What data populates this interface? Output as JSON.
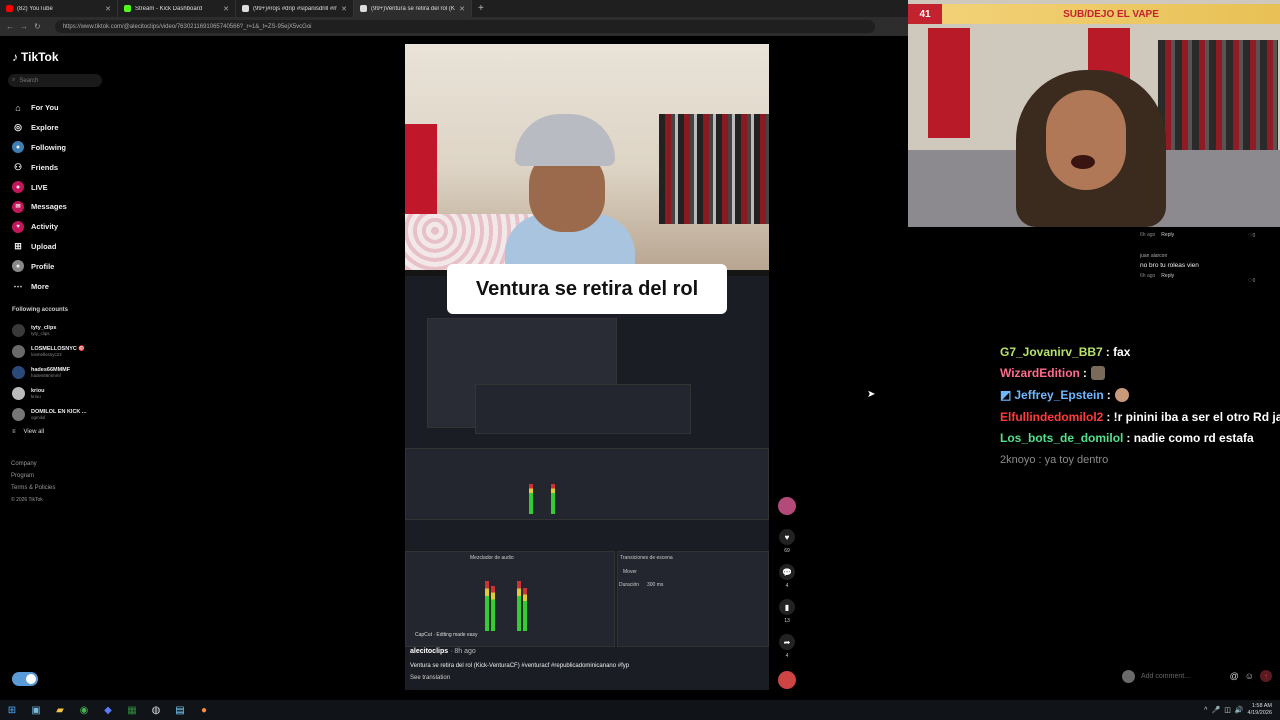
{
  "browser": {
    "tabs": [
      {
        "label": "(82) YouTube",
        "color": "#ff0000"
      },
      {
        "label": "Stream - Kick Dashboard",
        "color": "#53fc18"
      },
      {
        "label": "(99+)#rojs #drip #sipanisdrill #m",
        "color": "#ffffff"
      },
      {
        "label": "(99+)Ventura se retira del rol (Kic",
        "color": "#ffffff"
      }
    ],
    "url": "https://www.tiktok.com/@alecitoclips/video/7630211691065740566?_r=1&_t=ZS-95ejX5vcGoi"
  },
  "tiktok": {
    "logo": "TikTok",
    "search_placeholder": "Search",
    "menu": [
      {
        "label": "For You",
        "icon": "home-icon"
      },
      {
        "label": "Explore",
        "icon": "compass-icon"
      },
      {
        "label": "Following",
        "icon": "following-icon"
      },
      {
        "label": "Friends",
        "icon": "friends-icon"
      },
      {
        "label": "LIVE",
        "icon": "live-icon"
      },
      {
        "label": "Messages",
        "icon": "messages-icon"
      },
      {
        "label": "Activity",
        "icon": "activity-icon"
      },
      {
        "label": "Upload",
        "icon": "upload-icon"
      },
      {
        "label": "Profile",
        "icon": "profile-icon"
      },
      {
        "label": "More",
        "icon": "more-icon"
      }
    ],
    "following_title": "Following accounts",
    "accounts": [
      {
        "name": "tyty_clips",
        "handle": "tyty_clips"
      },
      {
        "name": "LOSMELLOSNYC 🎯",
        "handle": "losmellosnyc22"
      },
      {
        "name": "hades66MMMF",
        "handle": "hades66mmmf"
      },
      {
        "name": "kriou",
        "handle": "kriou"
      },
      {
        "name": "DOMILOL EN KICK ...",
        "handle": "ogmilol"
      }
    ],
    "view_all": "View all",
    "footer": [
      "Company",
      "Program",
      "Terms & Policies",
      "© 2026 TikTok"
    ]
  },
  "video": {
    "caption": "Ventura se retira del rol",
    "obs_audio_label": "Mezclador de audio",
    "obs_transitions_label": "Transiciones de escena",
    "obs_transition_value": "Mover",
    "obs_duration_label": "Duración",
    "obs_duration_value": "300 ms",
    "capcut_tag": "CapCut · Editing made easy",
    "author": "alecitoclips",
    "posted": " · 8h ago",
    "description": "Ventura se retira del rol (Kick-VenturaCF) #venturacf #republicadominicanano #fyp",
    "see_translation": "See translation"
  },
  "actions": {
    "likes": "69",
    "comments": "4",
    "saves": "13",
    "shares": "4"
  },
  "webcam": {
    "badge": "41",
    "banner": "SUB/DEJO EL VAPE"
  },
  "comments": [
    {
      "meta": "6h ago",
      "reply": "Reply",
      "likes": "0"
    },
    {
      "author": "juan alarcon",
      "text": "no bro tu roleas vien",
      "meta": "6h ago",
      "reply": "Reply",
      "likes": "0"
    }
  ],
  "chat": [
    {
      "user": "G7_Jovanirv_BB7",
      "color": "#b7e36b",
      "msg": ": fax",
      "emote": false
    },
    {
      "user": "WizardEdition",
      "color": "#ff6b8a",
      "msg": ":",
      "emote": true
    },
    {
      "user": "Jeffrey_Epstein",
      "color": "#6fb7ff",
      "msg": ":",
      "emote": true
    },
    {
      "user": "Elfullindedomilol2",
      "color": "#ff3b3b",
      "msg": ": !r pinini iba a ser el otro Rd javi p",
      "emote": false
    },
    {
      "user": "Los_bots_de_domilol",
      "color": "#54e08a",
      "msg": ": nadie como rd estafa",
      "emote": false
    },
    {
      "user": "2knoyo",
      "color": "#8a8a8a",
      "msg": ": ya toy dentro",
      "emote": false
    }
  ],
  "add_comment_placeholder": "Add comment...",
  "taskbar": {
    "time": "1:58 AM",
    "date": "4/19/2026"
  }
}
